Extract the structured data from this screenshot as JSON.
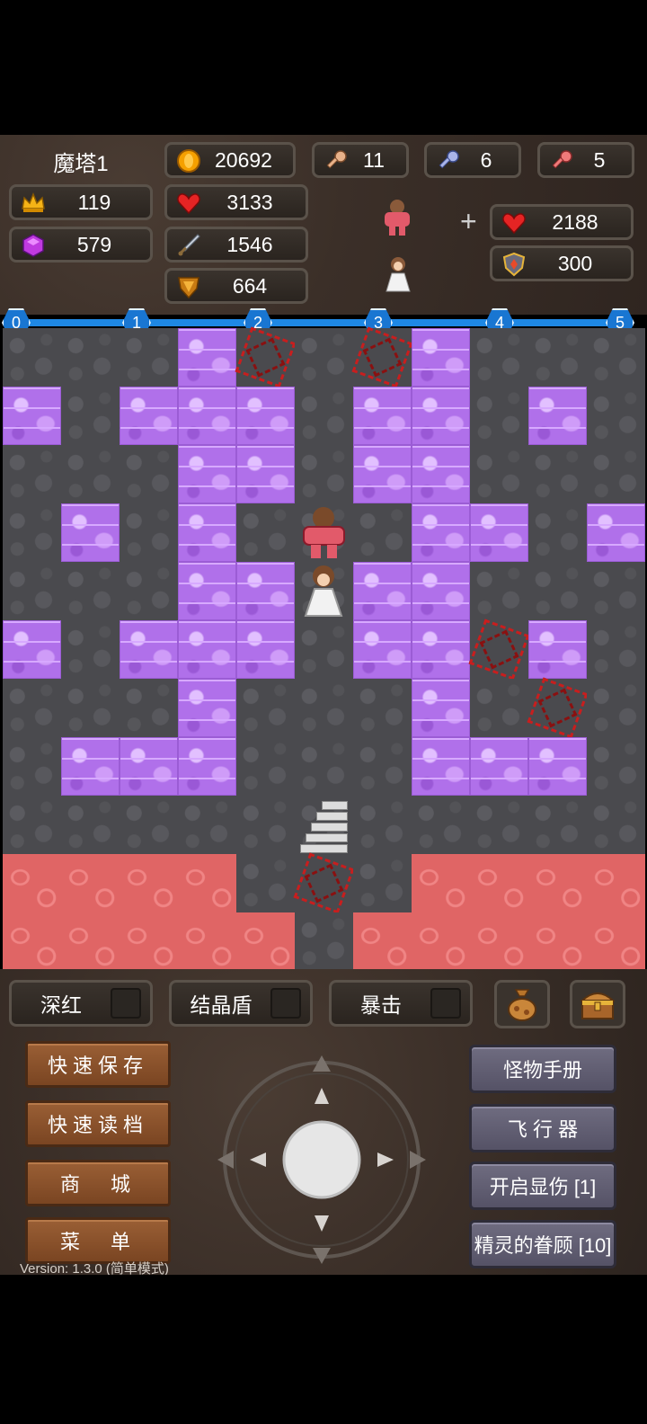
{
  "floor_title": "魔塔1",
  "stats": {
    "level": "119",
    "gems": "579",
    "gold": "20692",
    "hp": "3133",
    "attack": "1546",
    "defense": "664",
    "yellow_keys": "11",
    "blue_keys": "6",
    "red_keys": "5"
  },
  "companion": {
    "plus": "+",
    "hp": "2188",
    "defense": "300"
  },
  "progress": [
    "0",
    "1",
    "2",
    "3",
    "4",
    "5"
  ],
  "map": [
    "FFFWCFCWFFF",
    "WFWWWFWWFWF",
    "FFFWWFWWFFF",
    "FWFWFHFWWFW",
    "FFFWWPWWFFF",
    "WFWWWFWWCWF",
    "FFFWFFFWFCF",
    "FWWWFFFWWWF",
    "FFFFFSFFFFF",
    "LLLLFCFLLLL",
    "LLLLLFLLLLL"
  ],
  "toggles": [
    {
      "label": "深红"
    },
    {
      "label": "结晶盾"
    },
    {
      "label": "暴击"
    }
  ],
  "left_buttons": [
    "快速保存",
    "快速读档",
    "商　城",
    "菜　单"
  ],
  "right_buttons": [
    "怪物手册",
    "飞 行 器",
    "开启显伤 [1]",
    "精灵的眷顾 [10]"
  ],
  "version": "Version: 1.3.0 (简单模式)"
}
